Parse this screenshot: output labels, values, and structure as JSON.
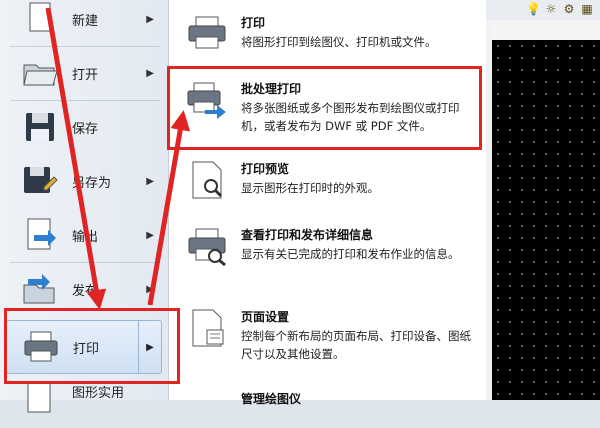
{
  "left_menu": {
    "items": [
      {
        "label": "新建",
        "icon": "new-file-icon"
      },
      {
        "label": "打开",
        "icon": "open-folder-icon"
      },
      {
        "label": "保存",
        "icon": "save-disk-icon"
      },
      {
        "label": "另存为",
        "icon": "save-as-icon"
      },
      {
        "label": "输出",
        "icon": "export-icon"
      },
      {
        "label": "发布",
        "icon": "publish-icon"
      },
      {
        "label": "打印",
        "icon": "printer-icon"
      },
      {
        "label": "图形实用",
        "icon": "drawing-utilities-icon"
      }
    ]
  },
  "submenu": {
    "items": [
      {
        "title": "打印",
        "desc": "将图形打印到绘图仪、打印机或文件。",
        "icon": "printer-icon"
      },
      {
        "title": "批处理打印",
        "desc": "将多张图纸或多个图形发布到绘图仪或打印机，或者发布为 DWF 或 PDF 文件。",
        "icon": "batch-plot-icon"
      },
      {
        "title": "打印预览",
        "desc": "显示图形在打印时的外观。",
        "icon": "plot-preview-icon"
      },
      {
        "title": "查看打印和发布详细信息",
        "desc": "显示有关已完成的打印和发布作业的信息。",
        "icon": "plot-details-icon"
      },
      {
        "title": "页面设置",
        "desc": "控制每个新布局的页面布局、打印设备、图纸尺寸以及其他设置。",
        "icon": "page-setup-icon"
      },
      {
        "title": "管理绘图仪",
        "desc": "",
        "icon": "manage-plotters-icon"
      }
    ]
  },
  "colors": {
    "highlight": "#e02424",
    "canvas": "#000000"
  }
}
